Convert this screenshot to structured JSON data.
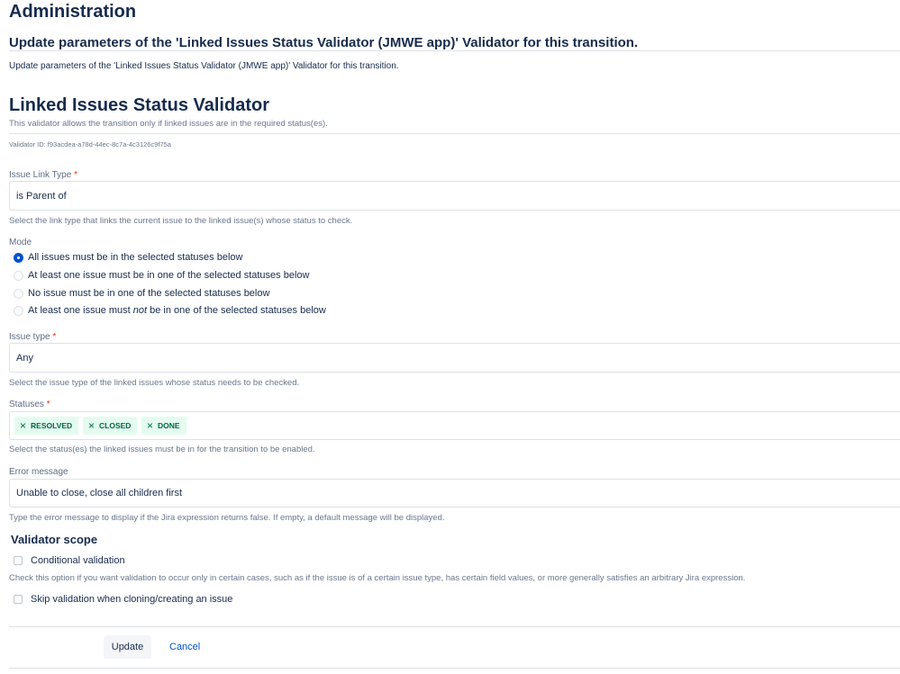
{
  "page": {
    "title": "Administration",
    "heading": "Update parameters of the 'Linked Issues Status Validator (JMWE app)' Validator for this transition.",
    "description": "Update parameters of the 'Linked Issues Status Validator (JMWE app)' Validator for this transition."
  },
  "validator": {
    "title": "Linked Issues Status Validator",
    "description": "This validator allows the transition only if linked issues are in the required status(es).",
    "id_text": "Validator ID: f93acdea-a78d-44ec-8c7a-4c3126c9f75a"
  },
  "issue_link_type": {
    "label": "Issue Link Type",
    "required": "*",
    "value": "is Parent of",
    "help": "Select the link type that links the current issue to the linked issue(s) whose status to check."
  },
  "mode": {
    "label": "Mode",
    "options": [
      {
        "label": "All issues must be in the selected statuses below",
        "selected": true
      },
      {
        "label": "At least one issue must be in one of the selected statuses below",
        "selected": false
      },
      {
        "label": "No issue must be in one of the selected statuses below",
        "selected": false
      },
      {
        "label_before": "At least one issue must ",
        "label_em": "not",
        "label_after": " be in one of the selected statuses below",
        "selected": false
      }
    ]
  },
  "issue_type": {
    "label": "Issue type",
    "required": "*",
    "value": "Any",
    "help": "Select the issue type of the linked issues whose status needs to be checked."
  },
  "statuses": {
    "label": "Statuses",
    "required": "*",
    "tags": [
      "RESOLVED",
      "CLOSED",
      "DONE"
    ],
    "remove_glyph": "×",
    "help": "Select the status(es) the linked issues must be in for the transition to be enabled."
  },
  "error_message": {
    "label": "Error message",
    "value": "Unable to close, close all children first",
    "help": "Type the error message to display if the Jira expression returns false. If empty, a default message will be displayed."
  },
  "scope": {
    "title": "Validator scope",
    "conditional_label": "Conditional validation",
    "conditional_help": "Check this option if you want validation to occur only in certain cases, such as if the issue is of a certain issue type, has certain field values, or more generally satisfies an arbitrary Jira expression.",
    "skip_label": "Skip validation when cloning/creating an issue"
  },
  "actions": {
    "update": "Update",
    "cancel": "Cancel"
  },
  "colors": {
    "primary": "#0052cc",
    "tag_bg": "#e3fcef",
    "tag_text": "#006644",
    "required": "#de350b"
  }
}
